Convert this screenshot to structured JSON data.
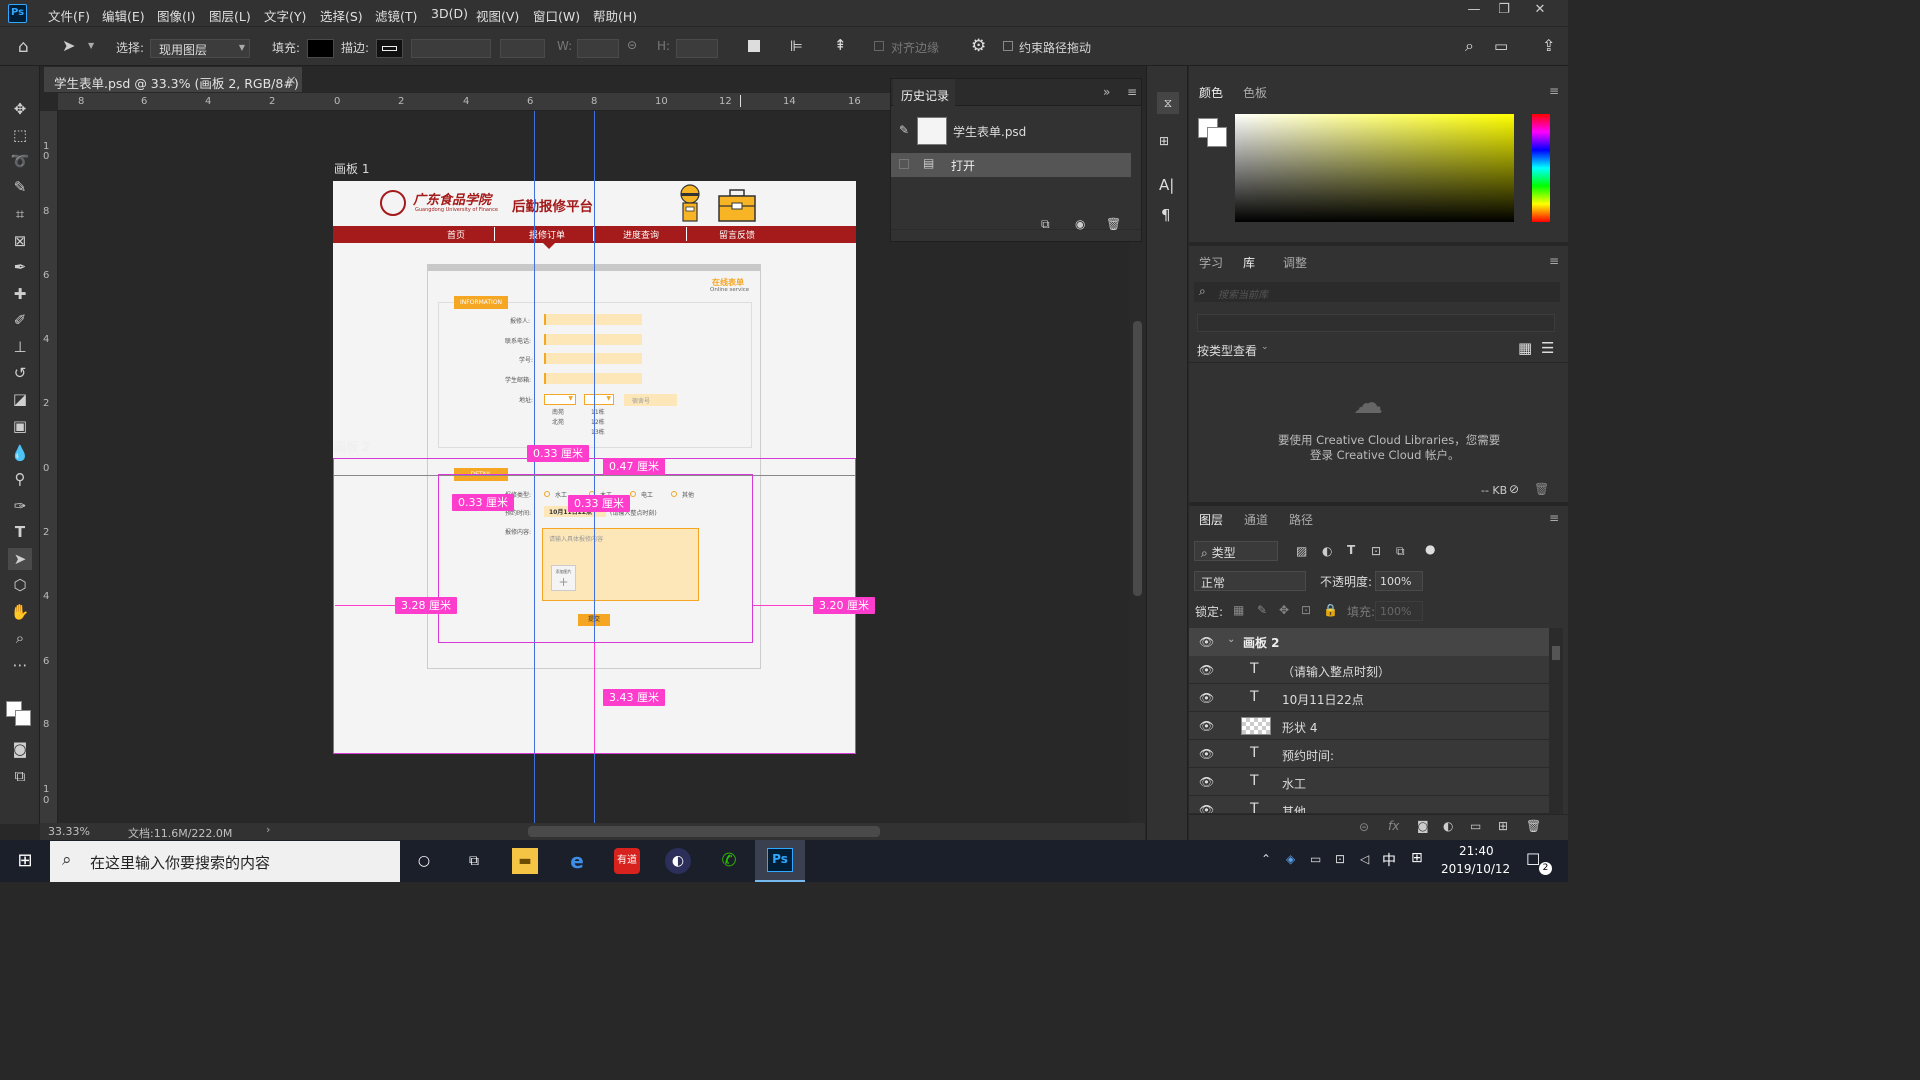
{
  "app": {
    "logo": "Ps"
  },
  "menu": [
    "文件(F)",
    "编辑(E)",
    "图像(I)",
    "图层(L)",
    "文字(Y)",
    "选择(S)",
    "滤镜(T)",
    "3D(D)",
    "视图(V)",
    "窗口(W)",
    "帮助(H)"
  ],
  "options": {
    "select_label": "选择:",
    "select_value": "现用图层",
    "fill_label": "填充:",
    "stroke_label": "描边:",
    "w_label": "W:",
    "h_label": "H:",
    "align_edges": "对齐边缘",
    "constrain_path": "约束路径拖动"
  },
  "document": {
    "tab_title": "学生表单.psd @ 33.3% (画板 2, RGB/8#)",
    "close": "×",
    "artboard1": "画板 1",
    "artboard2": "画板 2"
  },
  "ruler_top": [
    "8",
    "6",
    "4",
    "2",
    "0",
    "2",
    "4",
    "6",
    "8",
    "10",
    "12",
    "14",
    "16"
  ],
  "ruler_left": [
    "1",
    "0",
    "8",
    "6",
    "4",
    "2",
    "0",
    "2",
    "4",
    "6",
    "8",
    "1",
    "0"
  ],
  "design": {
    "school": "广东食品学院",
    "school_en": "Guangdong University of Finance",
    "platform": "后勤报修平台",
    "nav": [
      "首页",
      "报修订单",
      "进度查询",
      "留言反馈"
    ],
    "form_title": "在线表单",
    "form_sub": "Online service",
    "info_tag": "INFORMATION",
    "fields": [
      "报修人:",
      "联系电话:",
      "学号:",
      "学生邮箱:"
    ],
    "address_label": "地址:",
    "address_opts1": [
      "南苑",
      "北苑"
    ],
    "address_opts2": [
      "11栋",
      "12栋",
      "13栋"
    ],
    "room_placeholder": "宿舍号",
    "detail_tag": "DETAIL",
    "repair_type_label": "报修类型:",
    "repair_types": [
      "水工",
      "木工",
      "电工",
      "其他"
    ],
    "time_label": "预约时间:",
    "time_value": "10月11日22点",
    "time_hint": "(请输入整点时刻)",
    "content_label": "报修内容:",
    "content_placeholder": "请输入具体报修内容",
    "upload_label": "添加图片",
    "submit": "提交"
  },
  "measurements": {
    "m1": "0.33 厘米",
    "m2": "0.47 厘米",
    "m3": "0.33 厘米",
    "m4": "0.33 厘米",
    "m5": "3.28 厘米",
    "m6": "3.20 厘米",
    "m7": "3.43 厘米"
  },
  "status": {
    "zoom": "33.33%",
    "doc": "文档:11.6M/222.0M"
  },
  "history": {
    "title": "历史记录",
    "items": [
      "学生表单.psd",
      "打开"
    ]
  },
  "color_panel": {
    "tabs": [
      "颜色",
      "色板"
    ]
  },
  "library_panel": {
    "tabs": [
      "学习",
      "库",
      "调整"
    ],
    "search_placeholder": "搜索当前库",
    "view_by": "按类型查看",
    "msg1": "要使用 Creative Cloud Libraries，您需要",
    "msg2": "登录 Creative Cloud 帐户。",
    "kb": "-- KB"
  },
  "layers_panel": {
    "tabs": [
      "图层",
      "通道",
      "路径"
    ],
    "filter": "类型",
    "blend": "正常",
    "opacity_label": "不透明度:",
    "opacity": "100%",
    "lock_label": "锁定:",
    "fill_label": "填充:",
    "fill": "100%",
    "group": "画板 2",
    "layers": [
      {
        "type": "T",
        "name": "（请输入整点时刻）"
      },
      {
        "type": "T",
        "name": "10月11日22点"
      },
      {
        "type": "shape",
        "name": "形状 4"
      },
      {
        "type": "T",
        "name": "预约时间:"
      },
      {
        "type": "T",
        "name": "水工"
      },
      {
        "type": "T",
        "name": "其他"
      }
    ]
  },
  "taskbar": {
    "search": "在这里输入你要搜索的内容",
    "time": "21:40",
    "date": "2019/10/12",
    "ime": "中",
    "notif": "2"
  }
}
